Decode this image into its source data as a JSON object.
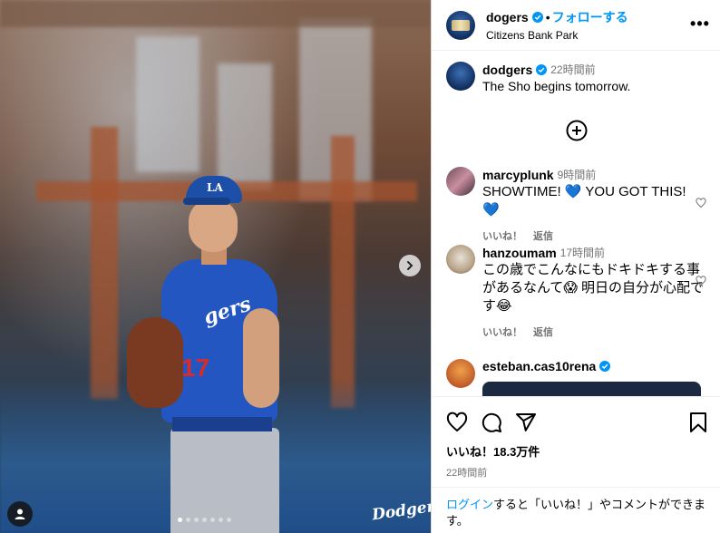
{
  "post": {
    "username": "dogers",
    "follow_label": "フォローする",
    "separator": "•",
    "location": "Citizens Bank Park",
    "more_label": "•••",
    "watermark": "Dodgers",
    "carousel": {
      "total_dots": 7,
      "active_dot": 0
    }
  },
  "caption": {
    "username": "dodgers",
    "time": "22時間前",
    "text": "The Sho begins tomorrow."
  },
  "comments": [
    {
      "username": "marcyplunk",
      "time": "9時間前",
      "text": "SHOWTIME! 💙 YOU GOT THIS! 💙",
      "like_label": "いいね！",
      "reply_label": "返信"
    },
    {
      "username": "hanzoumam",
      "time": "17時間前",
      "text": "この歳でこんなにもドキドキする事があるなんて😱 明日の自分が心配です😂",
      "like_label": "いいね！",
      "reply_label": "返信"
    },
    {
      "username": "esteban.cas10rena",
      "time": "",
      "text": ""
    }
  ],
  "footer": {
    "likes": "いいね！18.3万件",
    "posted_ago": "22時間前",
    "login_link": "ログイン",
    "login_rest": "すると「いいね！」やコメントができます。"
  },
  "colors": {
    "accent": "#0095f6",
    "muted": "#737373",
    "jersey_blue": "#2456c2"
  },
  "icons": [
    "verified-icon",
    "more-icon",
    "add-circle-icon",
    "heart-icon",
    "comment-icon",
    "share-icon",
    "bookmark-icon",
    "chevron-right-icon",
    "user-tag-icon"
  ]
}
